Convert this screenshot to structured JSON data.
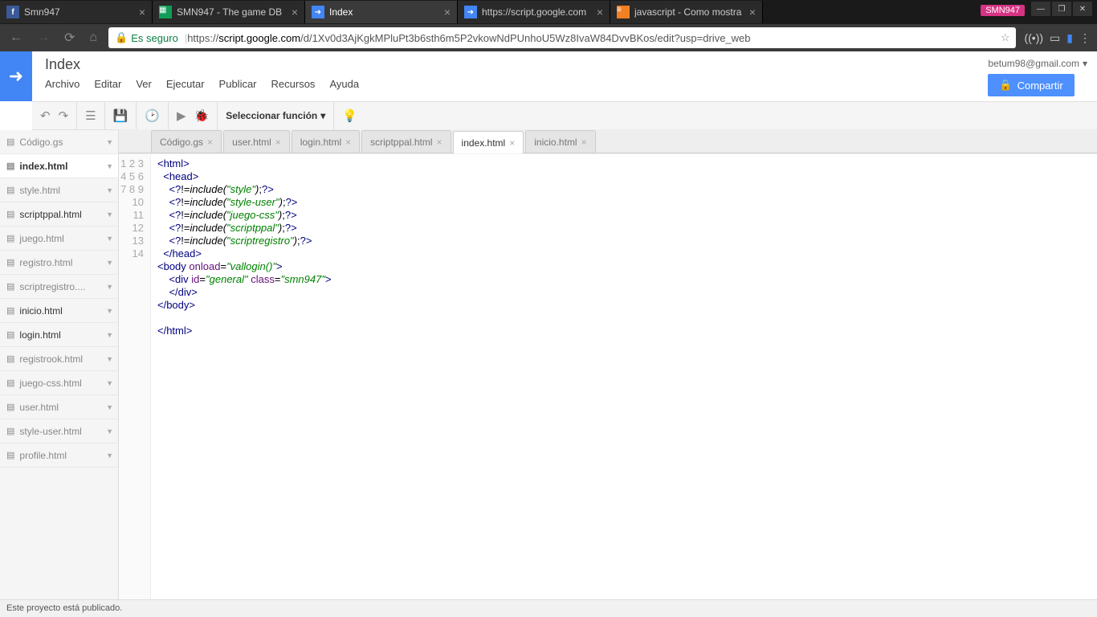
{
  "browser": {
    "tabs": [
      {
        "title": "Smn947",
        "favicon": "fb"
      },
      {
        "title": "SMN947 - The game DB",
        "favicon": "sheets"
      },
      {
        "title": "Index",
        "favicon": "script",
        "active": true
      },
      {
        "title": "https://script.google.com",
        "favicon": "script"
      },
      {
        "title": "javascript - Como mostra",
        "favicon": "so"
      }
    ],
    "win_user": "SMN947",
    "secure_label": "Es seguro",
    "url_host": "script.google.com",
    "url_path": "/d/1Xv0d3AjKgkMPluPt3b6sth6m5P2vkowNdPUnhoU5Wz8IvaW84DvvBKos/edit?usp=drive_web",
    "url_prefix": "https://"
  },
  "app": {
    "title": "Index",
    "menus": [
      "Archivo",
      "Editar",
      "Ver",
      "Ejecutar",
      "Publicar",
      "Recursos",
      "Ayuda"
    ],
    "email": "betum98@gmail.com",
    "share": "Compartir",
    "fn_select": "Seleccionar función"
  },
  "sidebar": [
    {
      "name": "Código.gs",
      "dim": true
    },
    {
      "name": "index.html",
      "active": true
    },
    {
      "name": "style.html",
      "dim": true
    },
    {
      "name": "scriptppal.html"
    },
    {
      "name": "juego.html",
      "dim": true
    },
    {
      "name": "registro.html",
      "dim": true
    },
    {
      "name": "scriptregistro....",
      "dim": true
    },
    {
      "name": "inicio.html"
    },
    {
      "name": "login.html"
    },
    {
      "name": "registrook.html",
      "dim": true
    },
    {
      "name": "juego-css.html",
      "dim": true
    },
    {
      "name": "user.html",
      "dim": true
    },
    {
      "name": "style-user.html",
      "dim": true
    },
    {
      "name": "profile.html",
      "dim": true
    }
  ],
  "editor_tabs": [
    {
      "name": "Código.gs"
    },
    {
      "name": "user.html"
    },
    {
      "name": "login.html"
    },
    {
      "name": "scriptppal.html"
    },
    {
      "name": "index.html",
      "active": true
    },
    {
      "name": "inicio.html"
    }
  ],
  "code": {
    "lines": 14,
    "includes": [
      "style",
      "style-user",
      "juego-css",
      "scriptppal",
      "scriptregistro"
    ],
    "body_onload": "vallogin()",
    "div_id": "general",
    "div_class": "smn947"
  },
  "status": "Este proyecto está publicado."
}
